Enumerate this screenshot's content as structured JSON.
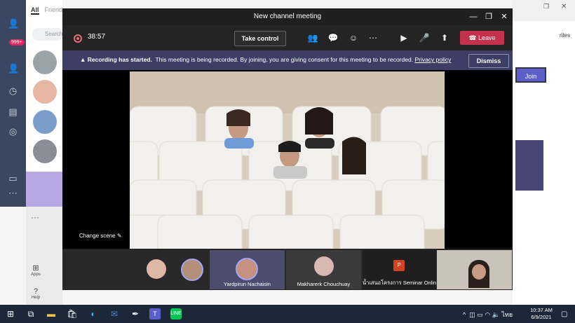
{
  "line_app": {
    "tabs": [
      "All",
      "Friend"
    ],
    "search_placeholder": "Search",
    "badge": "999+"
  },
  "teams_bg": {
    "more": "···",
    "apps_label": "Apps",
    "help_label": "Help",
    "join_label": "Join",
    "partial_text": "rites"
  },
  "meeting": {
    "title": "New channel meeting",
    "timer": "38:57",
    "take_control_label": "Take control",
    "leave_label": "Leave",
    "banner": {
      "bold": "Recording has started.",
      "text": "This meeting is being recorded. By joining, you are giving consent for this meeting to be recorded.",
      "link": "Privacy policy",
      "dismiss_label": "Dismiss"
    },
    "change_scene_label": "Change scene",
    "participants": [
      {
        "name": ""
      },
      {
        "name": ""
      },
      {
        "name": "Yardpirun Nachaisin"
      },
      {
        "name": "Makharerk Chouchuay"
      },
      {
        "name": "น้ำเสนอโครงการ Seminar Online..."
      },
      {
        "name": ""
      }
    ]
  },
  "taskbar": {
    "time": "10:37 AM",
    "date": "6/9/2021",
    "lang": "ไทย"
  },
  "colors": {
    "leave": "#c4314b",
    "banner": "#3d3e66",
    "accent": "#5b5fc7"
  }
}
